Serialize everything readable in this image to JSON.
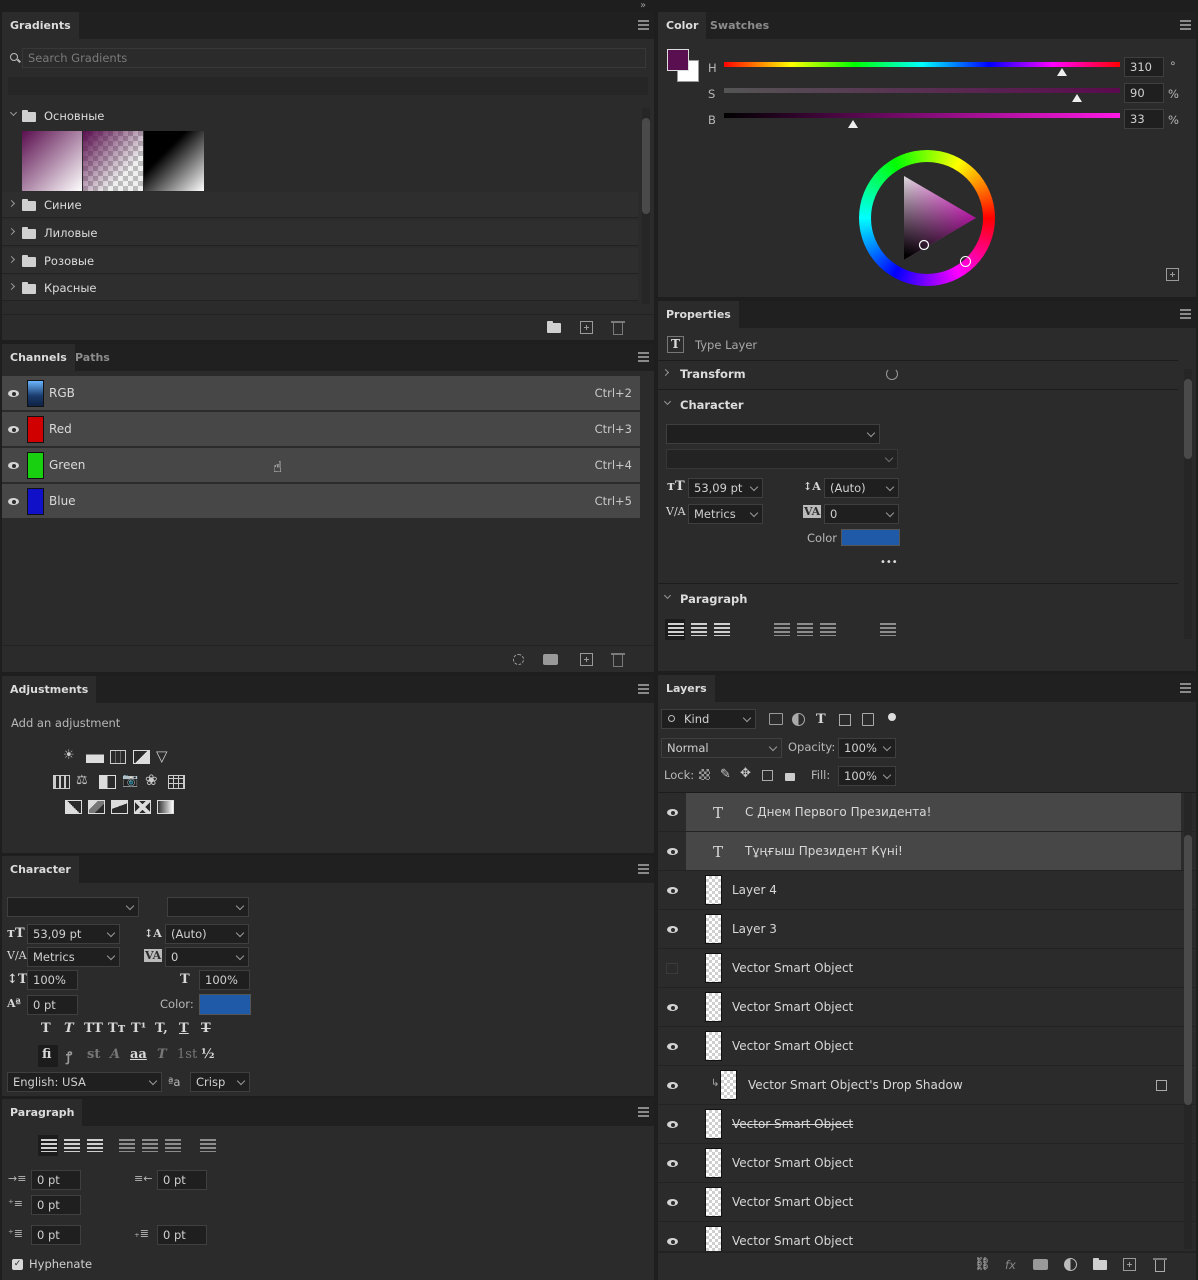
{
  "gradients": {
    "tab": "Gradients",
    "search_placeholder": "Search Gradients",
    "groups": [
      "Основные",
      "Синие",
      "Лиловые",
      "Розовые",
      "Красные"
    ]
  },
  "color": {
    "tabs": [
      "Color",
      "Swatches"
    ],
    "h_label": "H",
    "s_label": "S",
    "b_label": "B",
    "h": "310",
    "s": "90",
    "b": "33",
    "h_unit": "°",
    "s_unit": "%",
    "b_unit": "%",
    "foreground": "#5a1050"
  },
  "properties": {
    "tab": "Properties",
    "layer_type": "Type Layer",
    "transform": "Transform",
    "character": "Character",
    "size": "53,09 pt",
    "leading": "(Auto)",
    "kerning": "Metrics",
    "tracking": "0",
    "color_label": "Color",
    "text_color": "#1f5aa8",
    "paragraph": "Paragraph",
    "more": "•••"
  },
  "channels": {
    "tabs": [
      "Channels",
      "Paths"
    ],
    "rows": [
      {
        "name": "RGB",
        "shortcut": "Ctrl+2"
      },
      {
        "name": "Red",
        "shortcut": "Ctrl+3"
      },
      {
        "name": "Green",
        "shortcut": "Ctrl+4"
      },
      {
        "name": "Blue",
        "shortcut": "Ctrl+5"
      }
    ]
  },
  "adjustments": {
    "tab": "Adjustments",
    "hint": "Add an adjustment"
  },
  "character": {
    "tab": "Character",
    "size": "53,09 pt",
    "leading": "(Auto)",
    "kerning": "Metrics",
    "tracking": "0",
    "vscale": "100%",
    "hscale": "100%",
    "baseline": "0 pt",
    "color_label": "Color:",
    "text_color": "#1f5aa8",
    "language": "English: USA",
    "aa_label": "ªa",
    "antialias": "Crisp",
    "styles": [
      "T",
      "T",
      "TT",
      "Tт",
      "T¹",
      "T,",
      "T",
      "T"
    ],
    "opentype": [
      "fi",
      "ꝭ",
      "st",
      "A",
      "aa",
      "T",
      "1st",
      "½"
    ]
  },
  "paragraph": {
    "tab": "Paragraph",
    "indent_left": "0 pt",
    "indent_right": "0 pt",
    "indent_first": "0 pt",
    "space_before": "0 pt",
    "space_after": "0 pt",
    "hyphenate": "Hyphenate"
  },
  "layers": {
    "tab": "Layers",
    "filter_kind": "Kind",
    "blend": "Normal",
    "opacity_label": "Opacity:",
    "opacity": "100%",
    "lock_label": "Lock:",
    "fill_label": "Fill:",
    "fill": "100%",
    "rows": [
      {
        "name": "С Днем Первого Президента!",
        "type": "text"
      },
      {
        "name": "Тұңғыш Президент Күні!",
        "type": "text"
      },
      {
        "name": "Layer 4",
        "type": "smart"
      },
      {
        "name": "Layer 3",
        "type": "smart"
      },
      {
        "name": "Vector Smart Object",
        "type": "smart"
      },
      {
        "name": "Vector Smart Object",
        "type": "smart"
      },
      {
        "name": "Vector Smart Object",
        "type": "smart"
      },
      {
        "name": "Vector Smart Object's Drop Shadow",
        "type": "clip"
      },
      {
        "name": "Vector Smart Object",
        "type": "smart"
      },
      {
        "name": "Vector Smart Object",
        "type": "smart"
      },
      {
        "name": "Vector Smart Object",
        "type": "smart"
      },
      {
        "name": "Vector Smart Object",
        "type": "smart"
      }
    ],
    "footer_fx": "fx"
  }
}
